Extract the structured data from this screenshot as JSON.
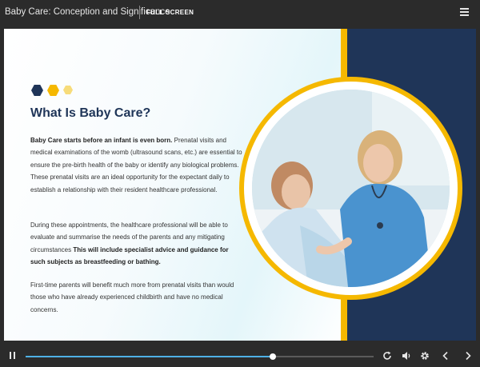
{
  "player": {
    "course_title": "Baby Care: Conception and Significance",
    "fullscreen_label": "FULL SCREEN",
    "progress": 0.71
  },
  "colors": {
    "navy": "#1f3558",
    "yellow": "#f5b800",
    "progress_blue": "#4fb1e6",
    "hex_light": "#f7dc7a"
  },
  "slide": {
    "heading": "What Is Baby Care?",
    "p1_bold": "Baby Care starts before an infant is even born.",
    "p1_text": " Prenatal visits and medical examinations of the womb (ultrasound scans, etc.) are essential to ensure the pre-birth health of the baby or identify any biological problems. These prenatal visits are an ideal opportunity for the expectant daily to establish a relationship with their resident healthcare professional.",
    "p2_text": "During these appointments, the healthcare professional will be able to evaluate and summarise the needs of the parents and any mitigating circumstances ",
    "p2_bold": "This will include specialist advice and guidance for such subjects as breastfeeding or bathing.",
    "p3_text": "First-time parents will benefit much more from prenatal visits than would those who have already experienced childbirth and have no medical concerns."
  },
  "icons": {
    "menu": "hamburger-menu-icon",
    "pause": "pause-icon",
    "replay": "replay-icon",
    "volume": "volume-icon",
    "settings": "gear-icon",
    "prev": "chevron-left-icon",
    "next": "chevron-right-icon"
  }
}
